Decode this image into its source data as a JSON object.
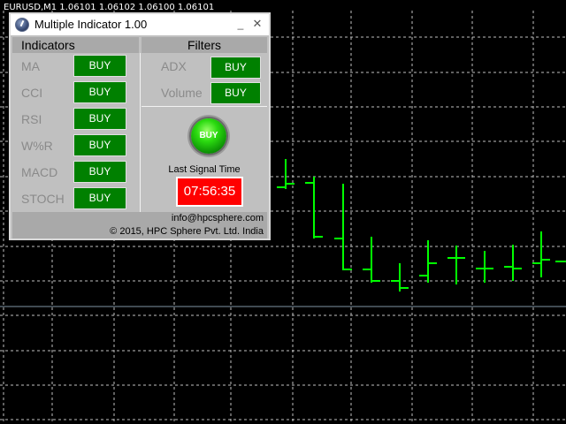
{
  "chart": {
    "symbol_line": "EURUSD,M1  1.06101 1.06102 1.06100 1.06101",
    "background": "#000000",
    "grid_color": "#c0c0c0",
    "candle_color": "#00ff00"
  },
  "window": {
    "title": "Multiple Indicator 1.00",
    "minimize_glyph": "_",
    "close_glyph": "✕"
  },
  "indicators": {
    "header": "Indicators",
    "items": [
      {
        "label": "MA",
        "button": "BUY"
      },
      {
        "label": "CCI",
        "button": "BUY"
      },
      {
        "label": "RSI",
        "button": "BUY"
      },
      {
        "label": "W%R",
        "button": "BUY"
      },
      {
        "label": "MACD",
        "button": "BUY"
      },
      {
        "label": "STOCH",
        "button": "BUY"
      }
    ]
  },
  "filters": {
    "header": "Filters",
    "items": [
      {
        "label": "ADX",
        "button": "BUY"
      },
      {
        "label": "Volume",
        "button": "BUY"
      }
    ]
  },
  "signal": {
    "light_text": "BUY",
    "last_signal_label": "Last Signal Time",
    "last_signal_time": "07:56:35",
    "light_color": "#2bdb10",
    "timer_color": "#ff0000"
  },
  "footer": {
    "email": "info@hpcsphere.com",
    "copyright": "© 2015, HPC Sphere Pvt. Ltd. India"
  }
}
